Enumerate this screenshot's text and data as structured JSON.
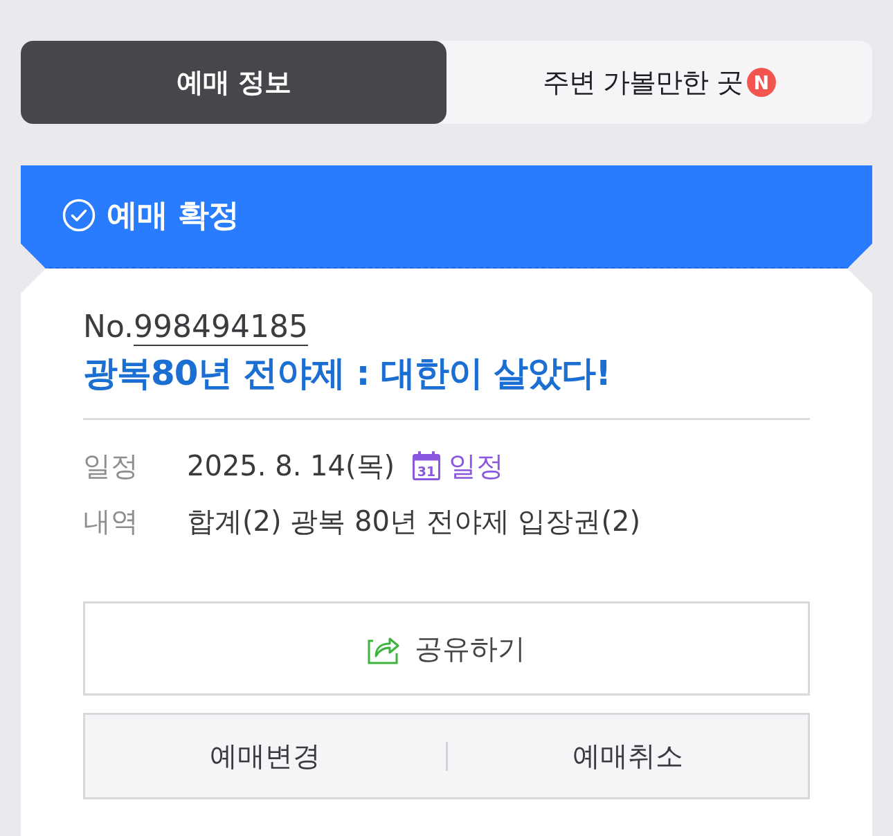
{
  "tabs": [
    {
      "label": "예매 정보",
      "selected": true
    },
    {
      "label": "주변 가볼만한 곳",
      "selected": false,
      "badge": "N"
    }
  ],
  "status_banner": {
    "title": "예매 확정"
  },
  "booking": {
    "number_prefix": "No.",
    "number": "998494185",
    "title": "광복80년 전야제 : 대한이 살았다!",
    "details": [
      {
        "label": "일정",
        "value": "2025. 8. 14(목)",
        "link": {
          "icon_text": "31",
          "label": "일정"
        }
      },
      {
        "label": "내역",
        "value": "합계(2) 광복 80년 전야제 입장권(2)"
      }
    ]
  },
  "share_button": {
    "label": "공유하기"
  },
  "actions": [
    {
      "label": "예매변경"
    },
    {
      "label": "예매취소"
    }
  ]
}
